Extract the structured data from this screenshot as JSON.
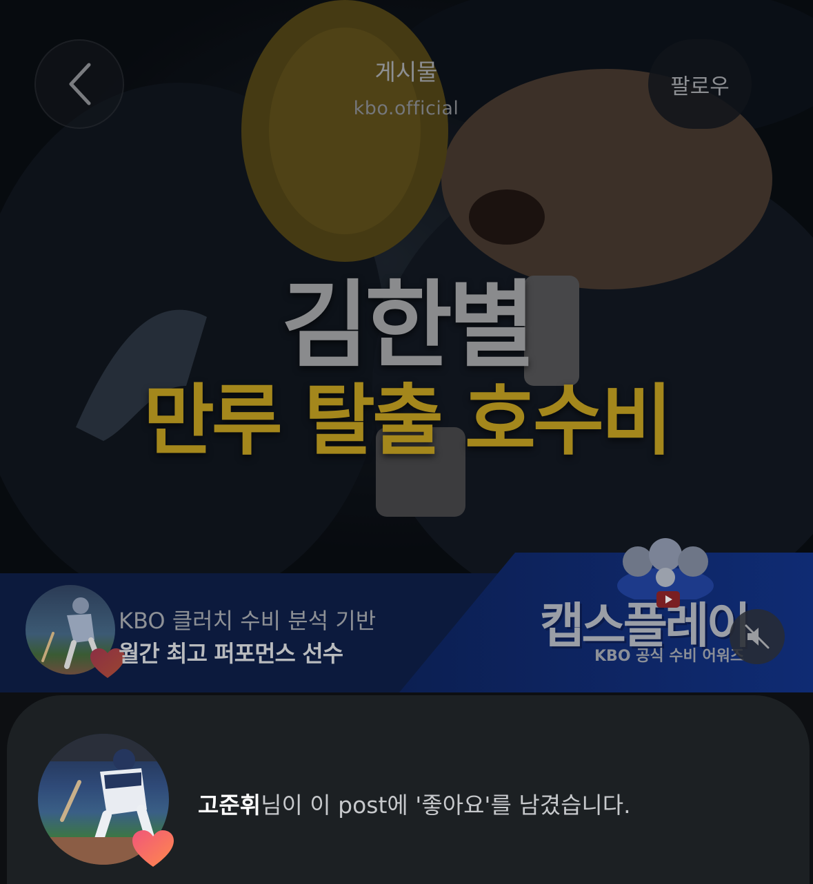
{
  "header": {
    "title": "게시물",
    "subtitle": "kbo.official",
    "follow_label": "팔로우"
  },
  "video": {
    "headline_main": "김한별",
    "headline_sub": "만루 탈출 호수비",
    "banner_line1": "KBO 클러치 수비 분석 기반",
    "banner_line2": "월간 최고 퍼포먼스 선수",
    "brand_title": "캡스플레이",
    "brand_subtitle": "KBO 공식 수비 어워즈"
  },
  "activity": {
    "liker_name": "고준휘",
    "message": "님이 이 post에 '좋아요'를 남겼습니다."
  },
  "colors": {
    "headline_gray": "#8a8b8d",
    "headline_gold": "#a4871c",
    "banner_navy": "#0c1a3d",
    "sheet_bg": "#1c2023",
    "heart_pink": "#f0567a",
    "heart_orange": "#ff8a4c"
  },
  "icons": {
    "back": "chevron-left-icon",
    "mute": "speaker-muted-icon",
    "like": "heart-icon"
  }
}
